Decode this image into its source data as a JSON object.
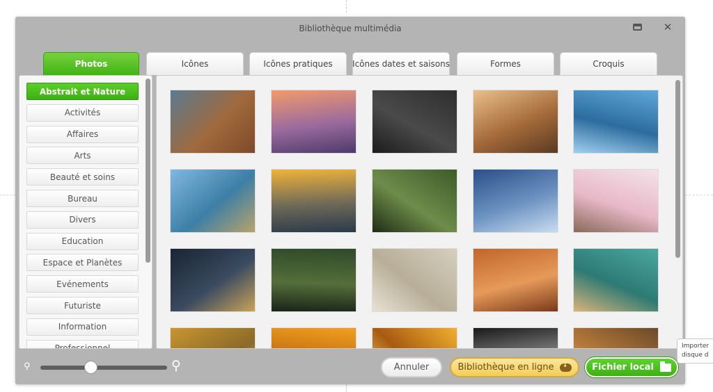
{
  "dialog": {
    "title": "Bibliothèque multimédia"
  },
  "tabs": [
    {
      "label": "Photos",
      "active": true
    },
    {
      "label": "Icônes",
      "active": false
    },
    {
      "label": "Icônes pratiques",
      "active": false
    },
    {
      "label": "Icônes dates et saisons",
      "active": false
    },
    {
      "label": "Formes",
      "active": false
    },
    {
      "label": "Croquis",
      "active": false
    }
  ],
  "categories": [
    {
      "label": "Abstrait et Nature",
      "active": true
    },
    {
      "label": "Activités"
    },
    {
      "label": "Affaires"
    },
    {
      "label": "Arts"
    },
    {
      "label": "Beauté et soins"
    },
    {
      "label": "Bureau"
    },
    {
      "label": "Divers"
    },
    {
      "label": "Education"
    },
    {
      "label": "Espace et Planètes"
    },
    {
      "label": "Evénements"
    },
    {
      "label": "Futuriste"
    },
    {
      "label": "Information"
    },
    {
      "label": "Professionnel"
    }
  ],
  "photos": [
    {
      "name": "photo-canyon-horseshoe-bend",
      "colors": [
        "#5c7a8f",
        "#a0693d",
        "#7d4a2a"
      ]
    },
    {
      "name": "photo-lake-sunset-island",
      "colors": [
        "#f29a6a",
        "#9b6b9e",
        "#4d3a6b"
      ]
    },
    {
      "name": "photo-dark-rain-texture",
      "colors": [
        "#2e2e2e",
        "#4a4a4a",
        "#1c1c1c"
      ]
    },
    {
      "name": "photo-golden-light-streaks",
      "colors": [
        "#e8c08a",
        "#a56a3a",
        "#5a3a22"
      ]
    },
    {
      "name": "photo-blue-ice-crystals",
      "colors": [
        "#5ea8d9",
        "#2d6c9e",
        "#9fd0ef"
      ]
    },
    {
      "name": "photo-mountain-lake-island",
      "colors": [
        "#7fb8e0",
        "#3d7fa6",
        "#b8a36a"
      ]
    },
    {
      "name": "photo-sunrise-over-fog",
      "colors": [
        "#f0b33a",
        "#6f6a58",
        "#2a3a4a"
      ]
    },
    {
      "name": "photo-leaf-water-drops",
      "colors": [
        "#3e5a2a",
        "#6e8c4a",
        "#1f2d14"
      ]
    },
    {
      "name": "photo-blue-mountain-layers",
      "colors": [
        "#2a4f8a",
        "#6d93c2",
        "#c9dcef"
      ]
    },
    {
      "name": "photo-cherry-blossoms",
      "colors": [
        "#f4e3e8",
        "#e8b8c8",
        "#8a6a5a"
      ]
    },
    {
      "name": "photo-earth-from-space-night",
      "colors": [
        "#1a2433",
        "#3a4a60",
        "#c9a35a"
      ]
    },
    {
      "name": "photo-green-cliffs-waterfall",
      "colors": [
        "#2f4a2a",
        "#556e3a",
        "#1a2418"
      ]
    },
    {
      "name": "photo-sand-ripples",
      "colors": [
        "#d6cfbf",
        "#b8ae98",
        "#e8e2d4"
      ]
    },
    {
      "name": "photo-sandstone-waves",
      "colors": [
        "#c2662a",
        "#e69a5a",
        "#7a3a1a"
      ]
    },
    {
      "name": "photo-turquoise-water-shore",
      "colors": [
        "#4aa8a0",
        "#2d7a74",
        "#d8b47a"
      ]
    },
    {
      "name": "photo-wheat-field",
      "colors": [
        "#c9952f",
        "#8a6a2a",
        "#e8c070"
      ]
    },
    {
      "name": "photo-orange-sky",
      "colors": [
        "#f0a020",
        "#c06a10",
        "#f8c860"
      ]
    },
    {
      "name": "photo-sun-glow",
      "colors": [
        "#f0b030",
        "#a85a10",
        "#f8d870"
      ]
    },
    {
      "name": "photo-metal-bubbles",
      "colors": [
        "#1a1a1a",
        "#8a8a8a",
        "#d0d0d0"
      ]
    },
    {
      "name": "photo-rocks-autumn",
      "colors": [
        "#6a4a2a",
        "#b87a3a",
        "#e8d0b0"
      ]
    }
  ],
  "bottom": {
    "cancel_label": "Annuler",
    "online_label": "Bibliothèque en ligne",
    "local_label": "Fichier local",
    "zoom_level": 0.4
  },
  "tooltip": {
    "line1": "Importer",
    "line2": "disque d"
  }
}
